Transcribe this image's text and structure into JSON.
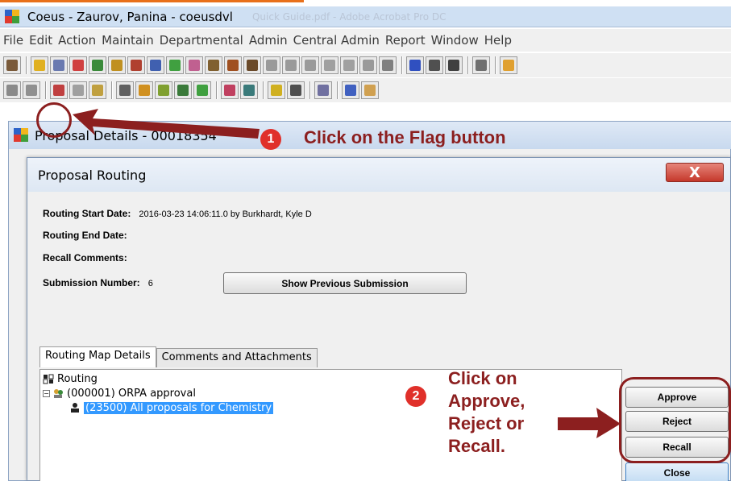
{
  "window": {
    "title": "Coeus - Zaurov, Panina - coeusdvl",
    "ghost_title": "Quick Guide.pdf - Adobe Acrobat Pro DC"
  },
  "menu": [
    "File",
    "Edit",
    "Action",
    "Maintain",
    "Departmental",
    "Admin",
    "Central Admin",
    "Report",
    "Window",
    "Help"
  ],
  "toolbar1_colors": [
    "#7a5a3a",
    "#e0b020",
    "#6a7ab0",
    "#d04040",
    "#3a8a3a",
    "#c09020",
    "#b04030",
    "#4060b0",
    "#40a040",
    "#c06090",
    "#806030",
    "#a05020",
    "#6a4a2a",
    "#9a9a9a",
    "#9a9a9a",
    "#9a9a9a",
    "#a0a0a0",
    "#a0a0a0",
    "#9a9a9a",
    "#808080",
    "#3050c0",
    "#505050",
    "#404040",
    "#707070",
    "#e0a030"
  ],
  "toolbar2_colors": [
    "#8a8a8a",
    "#909090",
    "#c04040",
    "#a0a0a0",
    "#c0a040",
    "#606060",
    "#d09020",
    "#80a030",
    "#3a7a3a",
    "#40a040",
    "#c04060",
    "#3a7a7a",
    "#d0b020",
    "#505050",
    "#7070a0",
    "#4060c0",
    "#d0a050"
  ],
  "inner_window": {
    "title": "Proposal Details - 00018354"
  },
  "dialog": {
    "title": "Proposal Routing",
    "routing_start_label": "Routing Start Date:",
    "routing_start_value": "2016-03-23 14:06:11.0 by Burkhardt, Kyle D",
    "routing_end_label": "Routing End Date:",
    "recall_label": "Recall Comments:",
    "submission_label": "Submission Number:",
    "submission_value": "6",
    "show_prev_button": "Show Previous Submission",
    "close_x": "X",
    "tabs": [
      "Routing Map Details",
      "Comments and Attachments"
    ],
    "tree": {
      "root": "Routing",
      "level1": "(000001) ORPA approval",
      "level2": "(23500) All proposals for Chemistry"
    },
    "buttons": {
      "approve": "Approve",
      "reject": "Reject",
      "recall": "Recall",
      "close": "Close"
    }
  },
  "annotations": {
    "step1_num": "1",
    "step1_text": "Click on the Flag button",
    "step2_num": "2",
    "step2_line1": "Click on",
    "step2_line2": "Approve,",
    "step2_line3": "Reject or",
    "step2_line4": "Recall."
  }
}
